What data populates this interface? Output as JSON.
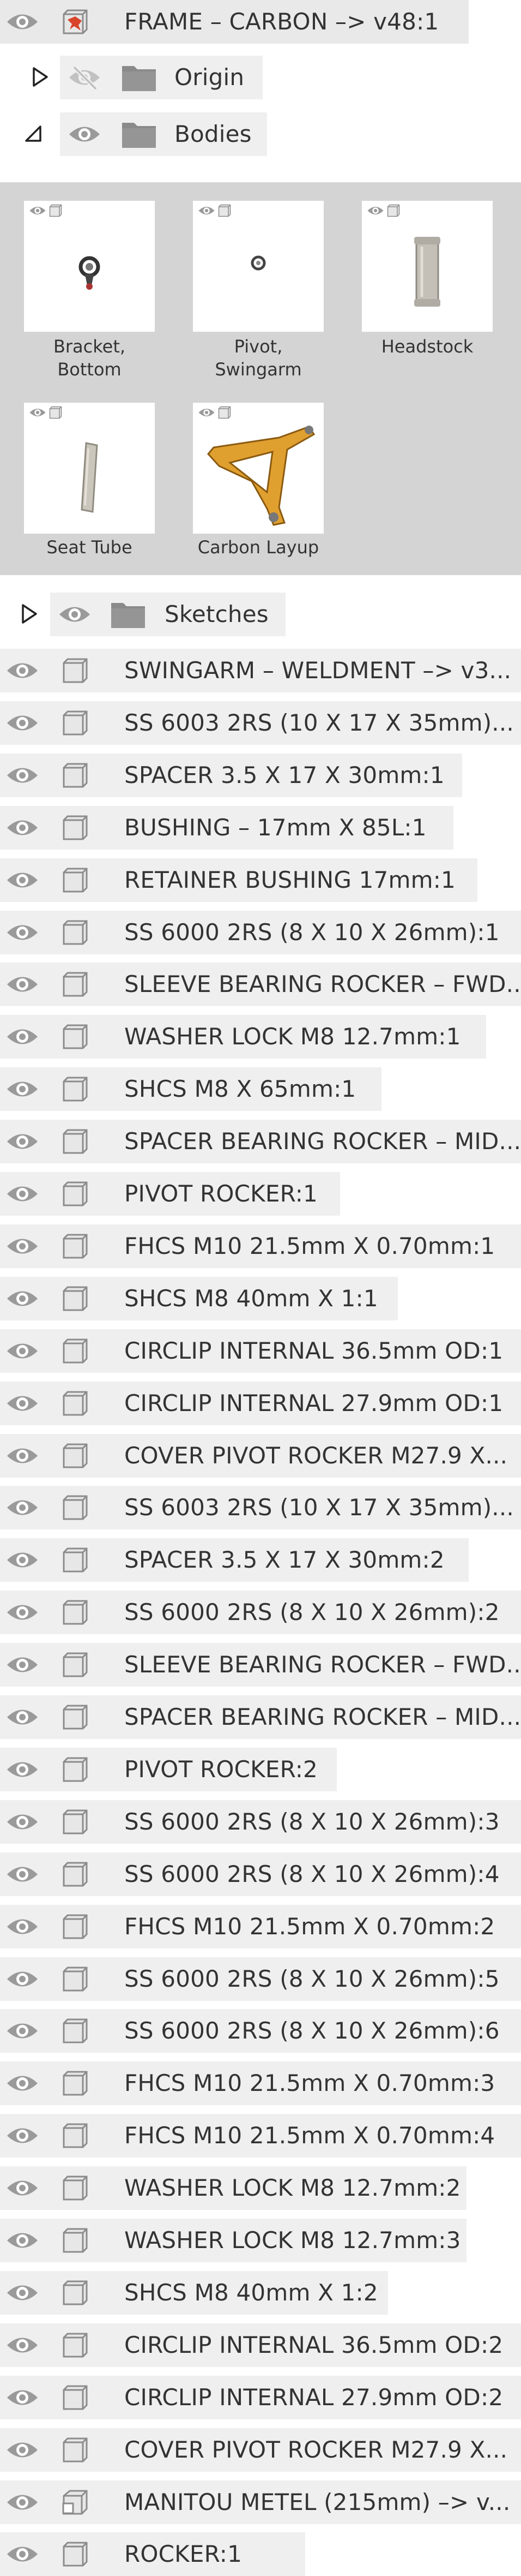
{
  "root": {
    "label": "FRAME – CARBON –> v48:1",
    "icon": "component-pinned-icon"
  },
  "origin": {
    "label": "Origin",
    "icon": "folder-icon",
    "visibility": "hidden"
  },
  "bodies": {
    "label": "Bodies",
    "icon": "folder-icon",
    "items": [
      {
        "label_line1": "Bracket,",
        "label_line2": "Bottom"
      },
      {
        "label_line1": "Pivot,",
        "label_line2": "Swingarm"
      },
      {
        "label_line1": "Headstock",
        "label_line2": ""
      },
      {
        "label_line1": "Seat Tube",
        "label_line2": ""
      },
      {
        "label_line1": "Carbon Layup",
        "label_line2": ""
      }
    ],
    "colors": {
      "layup": "#e0a030",
      "metal": "#b8b6b0"
    }
  },
  "sketches": {
    "label": "Sketches",
    "icon": "folder-icon"
  },
  "components": [
    "SWINGARM – WELDMENT –> v3...",
    "SS 6003 2RS (10 X 17 X 35mm)...",
    "SPACER 3.5 X 17 X 30mm:1",
    "BUSHING – 17mm X 85L:1",
    "RETAINER BUSHING 17mm:1",
    "SS 6000 2RS (8 X 10 X 26mm):1",
    "SLEEVE BEARING ROCKER – FWD...",
    "WASHER LOCK M8 12.7mm:1",
    "SHCS M8 X 65mm:1",
    "SPACER BEARING ROCKER – MID...",
    "PIVOT ROCKER:1",
    "FHCS M10 21.5mm X 0.70mm:1",
    "SHCS M8 40mm X 1:1",
    "CIRCLIP INTERNAL 36.5mm OD:1",
    "CIRCLIP INTERNAL 27.9mm OD:1",
    "COVER PIVOT ROCKER M27.9 X...",
    "SS 6003 2RS (10 X 17 X 35mm)...",
    "SPACER 3.5 X 17 X 30mm:2",
    "SS 6000 2RS (8 X 10 X 26mm):2",
    "SLEEVE BEARING ROCKER – FWD...",
    "SPACER BEARING ROCKER – MID...",
    "PIVOT ROCKER:2",
    "SS 6000 2RS (8 X 10 X 26mm):3",
    "SS 6000 2RS (8 X 10 X 26mm):4",
    "FHCS M10 21.5mm X 0.70mm:2",
    "SS 6000 2RS (8 X 10 X 26mm):5",
    "SS 6000 2RS (8 X 10 X 26mm):6",
    "FHCS M10 21.5mm X 0.70mm:3",
    "FHCS M10 21.5mm X 0.70mm:4",
    "WASHER LOCK M8 12.7mm:2",
    "WASHER LOCK M8 12.7mm:3",
    "SHCS M8 40mm X 1:2",
    "CIRCLIP INTERNAL 36.5mm OD:2",
    "CIRCLIP INTERNAL 27.9mm OD:2",
    "COVER PIVOT ROCKER M27.9 X...",
    "MANITOU METEL (215mm) –> v...",
    "ROCKER:1"
  ]
}
